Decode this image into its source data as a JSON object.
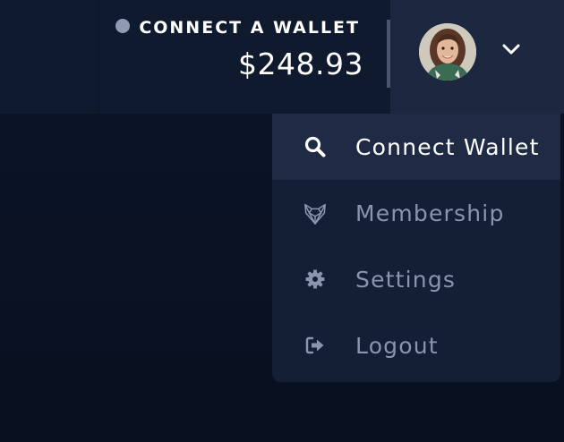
{
  "header": {
    "wallet_status": "CONNECT A WALLET",
    "balance": "$248.93"
  },
  "profile": {
    "avatar_icon": "user-avatar",
    "toggle_icon": "chevron-down-icon"
  },
  "menu": {
    "items": [
      {
        "label": "Connect Wallet",
        "icon": "search-icon",
        "active": true
      },
      {
        "label": "Membership",
        "icon": "fox-icon",
        "active": false
      },
      {
        "label": "Settings",
        "icon": "gear-icon",
        "active": false
      },
      {
        "label": "Logout",
        "icon": "logout-icon",
        "active": false
      }
    ]
  },
  "colors": {
    "background": "#0c1629",
    "header": "#0f1a2f",
    "profile_area": "#1c2740",
    "dropdown": "#141f36",
    "active_item": "#1f2b45",
    "status_dot": "#8f9bb3",
    "muted_text": "#8a95ad"
  }
}
